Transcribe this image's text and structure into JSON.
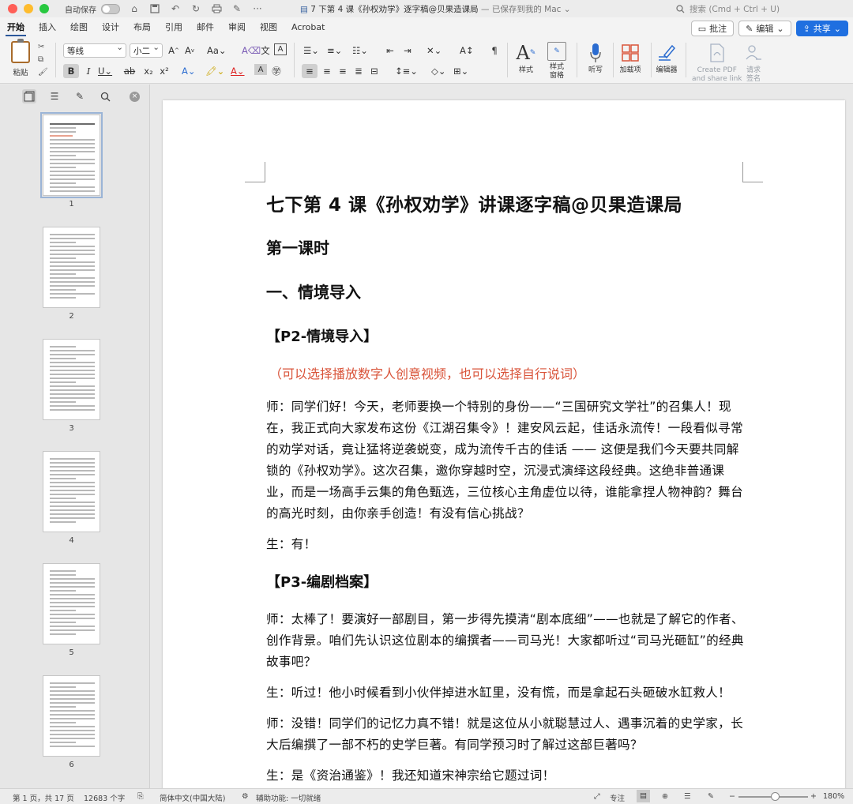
{
  "titlebar": {
    "autosave_label": "自动保存",
    "doc_title": "7 下第 4 课《孙权劝学》逐字稿@贝果造课局",
    "doc_status": "— 已保存到我的 Mac ⌄",
    "search_placeholder": "搜索 (Cmd + Ctrl + U)"
  },
  "ribbon_tabs": [
    "开始",
    "插入",
    "绘图",
    "设计",
    "布局",
    "引用",
    "邮件",
    "审阅",
    "视图",
    "Acrobat"
  ],
  "tab_actions": {
    "comment": "批注",
    "edit": "编辑",
    "share": "共享"
  },
  "ribbon": {
    "paste_label": "粘贴",
    "font_name": "等线",
    "font_size": "小二",
    "styles_label": "样式",
    "styles_pane_label": "样式\n窗格",
    "dictate_label": "听写",
    "addins_label": "加载项",
    "editor_label": "编辑器",
    "create_pdf_label": "Create PDF\nand share link",
    "request_sign_label": "请求\n签名"
  },
  "nav_pane": {
    "pages": [
      "1",
      "2",
      "3",
      "4",
      "5",
      "6"
    ],
    "selected_page": "1"
  },
  "document": {
    "title": "七下第 4 课《孙权劝学》讲课逐字稿@贝果造课局",
    "lesson": "第一课时",
    "section1": "一、情境导入",
    "p2_heading": "【P2-情境导入】",
    "p2_note": "（可以选择播放数字人创意视频，也可以选择自行说词）",
    "p2_teacher": "师：同学们好！今天，老师要换一个特别的身份——“三国研究文学社”的召集人！现在，我正式向大家发布这份《江湖召集令》！建安风云起，佳话永流传！一段看似寻常的劝学对话，竟让猛将逆袭蜕变，成为流传千古的佳话 —— 这便是我们今天要共同解锁的《孙权劝学》。这次召集，邀你穿越时空，沉浸式演绎这段经典。这绝非普通课业，而是一场高手云集的角色甄选，三位核心主角虚位以待，谁能拿捏人物神韵？舞台的高光时刻，由你亲手创造！有没有信心挑战？",
    "p2_student": "生：有！",
    "p3_heading": "【P3-编剧档案】",
    "p3_teacher1": "师：太棒了！要演好一部剧目，第一步得先摸清“剧本底细”——也就是了解它的作者、创作背景。咱们先认识这位剧本的编撰者——司马光！大家都听过“司马光砸缸”的经典故事吧？",
    "p3_student1": "生：听过！他小时候看到小伙伴掉进水缸里，没有慌，而是拿起石头砸破水缸救人！",
    "p3_teacher2": "师：没错！同学们的记忆力真不错！就是这位从小就聪慧过人、遇事沉着的史学家，长大后编撰了一部不朽的史学巨著。有同学预习时了解过这部巨著吗？",
    "p3_student2": "生：是《资治通鉴》！我还知道宋神宗给它题过词！"
  },
  "statusbar": {
    "page_info": "第 1 页，共 17 页",
    "word_count": "12683 个字",
    "language": "简体中文(中国大陆)",
    "accessibility": "辅助功能: 一切就绪",
    "focus": "专注",
    "zoom": "180%"
  },
  "colors": {
    "accent": "#2b579a",
    "share_button": "#1f6fe0",
    "note_red": "#d9543a"
  }
}
